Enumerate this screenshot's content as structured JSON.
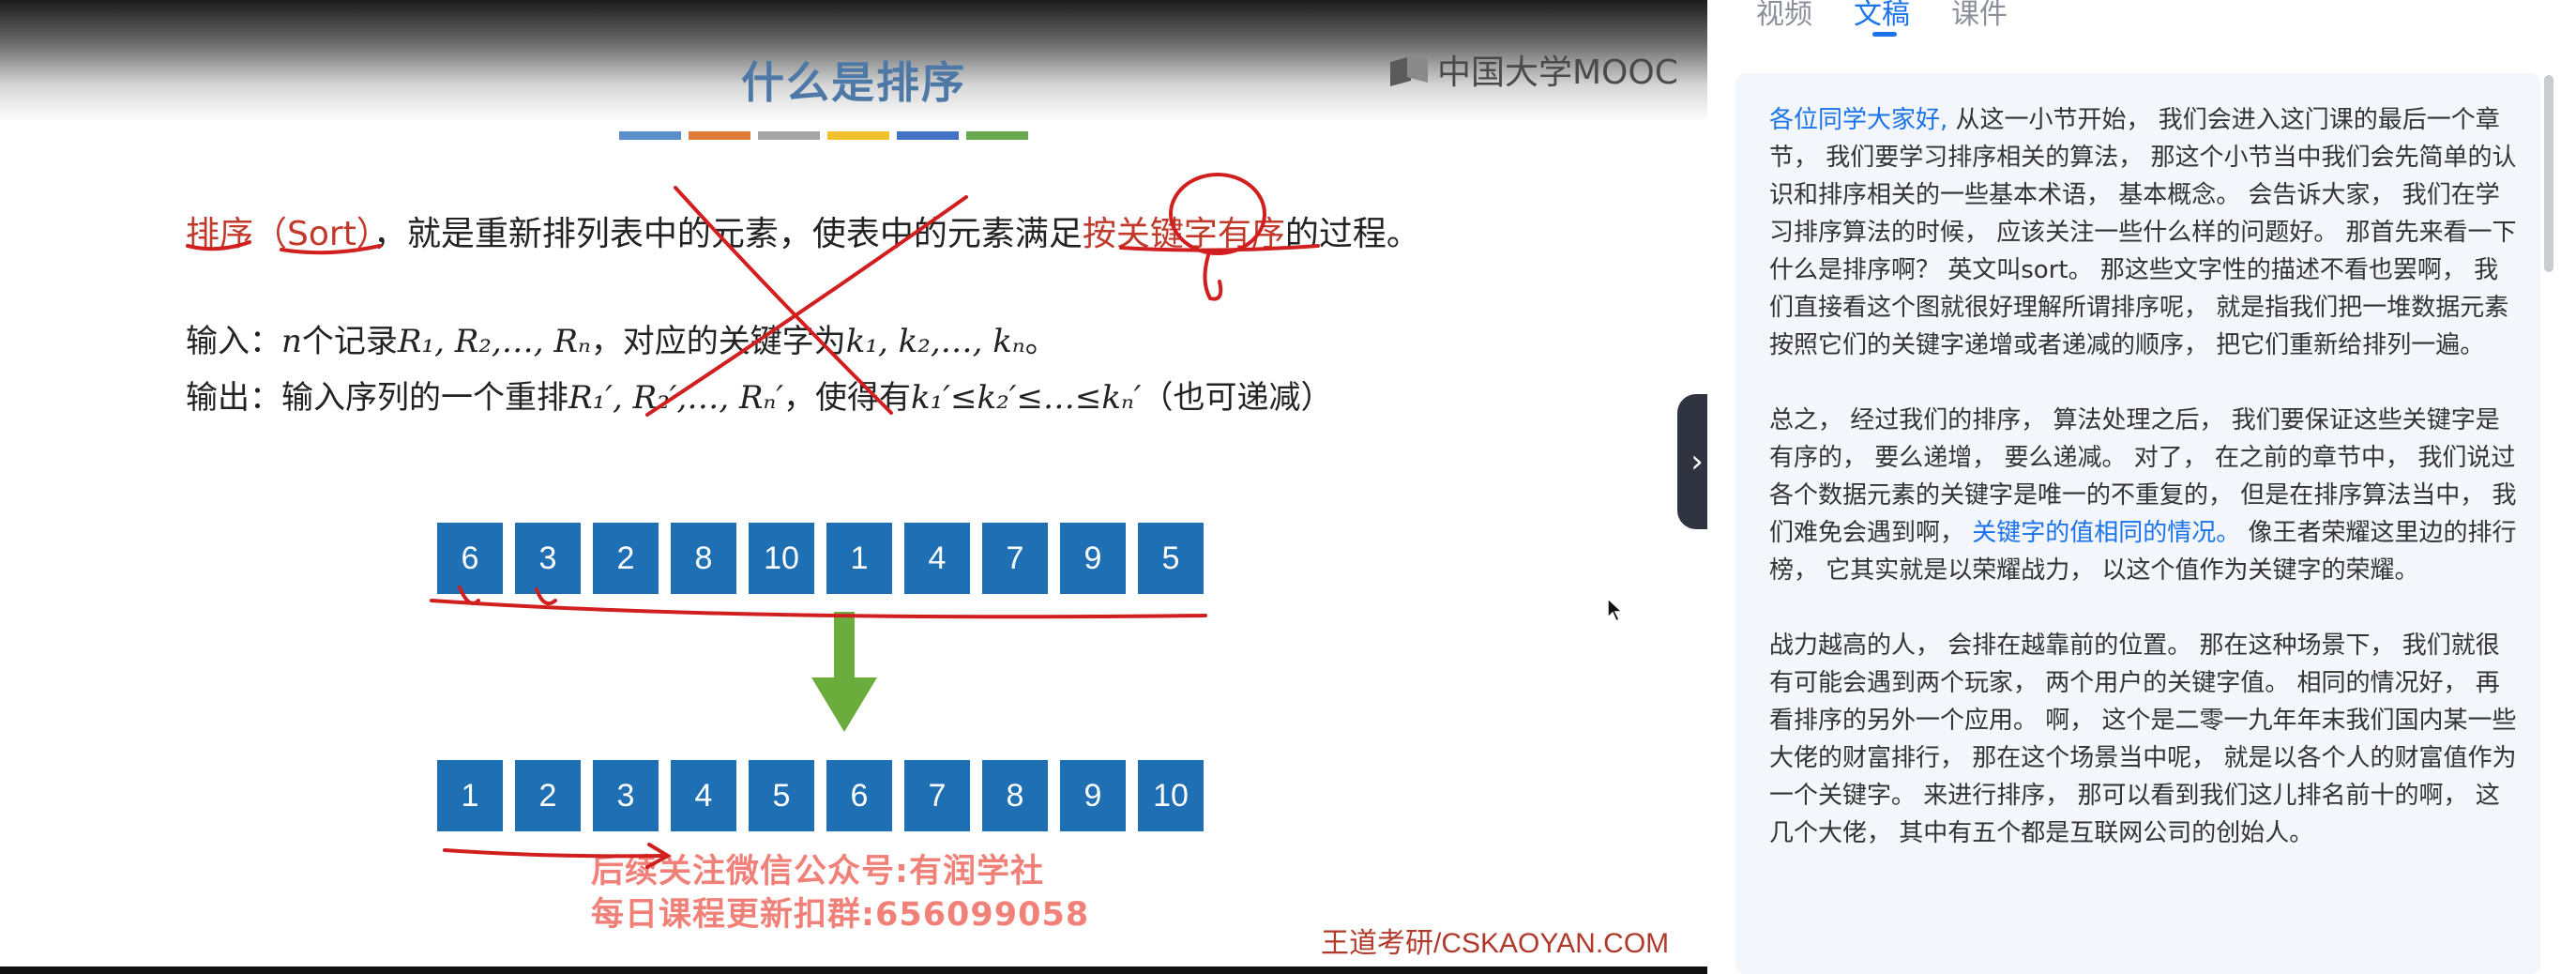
{
  "slide": {
    "title": "什么是排序",
    "rule_colors": [
      "#5b8fc9",
      "#e07b39",
      "#a5a5a5",
      "#f2c12e",
      "#4472c4",
      "#6aa84f"
    ],
    "logo": "中国大学MOOC",
    "definition": {
      "term": "排序",
      "sort_word": "（Sort）",
      "body": "，就是重新排列表中的元素，使表中的元素满足",
      "key_phrase": "按关键字有序",
      "tail": "的过程。"
    },
    "input_label": "输入：",
    "input_math": "n",
    "input_text1": "个记录",
    "input_math2": "R₁, R₂,…, Rₙ",
    "input_text2": "，对应的关键字为",
    "input_math3": "k₁, k₂,…, kₙ",
    "input_text3": "。",
    "output_label": "输出：",
    "output_text1": "输入序列的一个重排",
    "output_math1": "R₁′, R₂′,…, Rₙ′",
    "output_text2": "，使得有",
    "output_math2": "k₁′≤k₂′≤…≤kₙ′",
    "output_text3": "（也可递减）",
    "before": [
      "6",
      "3",
      "2",
      "8",
      "10",
      "1",
      "4",
      "7",
      "9",
      "5"
    ],
    "after": [
      "1",
      "2",
      "3",
      "4",
      "5",
      "6",
      "7",
      "8",
      "9",
      "10"
    ],
    "watermark_line1": "后续关注微信公众号:有润学社",
    "watermark_line2": "每日课程更新扣群:656099058",
    "credit": "王道考研/CSKAOYAN.COM",
    "collapse_icon": "chevron-right-icon"
  },
  "panel": {
    "tabs": [
      {
        "label": "视频",
        "active": false
      },
      {
        "label": "文稿",
        "active": true
      },
      {
        "label": "课件",
        "active": false
      }
    ],
    "p1_hl": "各位同学大家好,",
    "p1": " 从这一小节开始， 我们会进入这门课的最后一个章节， 我们要学习排序相关的算法， 那这个小节当中我们会先简单的认识和排序相关的一些基本术语， 基本概念。 会告诉大家， 我们在学习排序算法的时候， 应该关注一些什么样的问题好。 那首先来看一下什么是排序啊？ 英文叫sort。 那这些文字性的描述不看也罢啊， 我们直接看这个图就很好理解所谓排序呢， 就是指我们把一堆数据元素按照它们的关键字递增或者递减的顺序， 把它们重新给排列一遍。",
    "p2a": "总之， 经过我们的排序， 算法处理之后， 我们要保证这些关键字是有序的， 要么递增， 要么递减。 对了， 在之前的章节中， 我们说过各个数据元素的关键字是唯一的不重复的， 但是在排序算法当中， 我们难免会遇到啊， ",
    "p2_hl": "关键字的值相同的情况。",
    "p2b": " 像王者荣耀这里边的排行榜， 它其实就是以荣耀战力， 以这个值作为关键字的荣耀。",
    "p3": "战力越高的人， 会排在越靠前的位置。 那在这种场景下， 我们就很有可能会遇到两个玩家， 两个用户的关键字值。 相同的情况好， 再看排序的另外一个应用。 啊， 这个是二零一九年年末我们国内某一些大佬的财富排行， 那在这个场景当中呢， 就是以各个人的财富值作为一个关键字。 来进行排序， 那可以看到我们这儿排名前十的啊， 这几个大佬， 其中有五个都是互联网公司的创始人。"
  }
}
